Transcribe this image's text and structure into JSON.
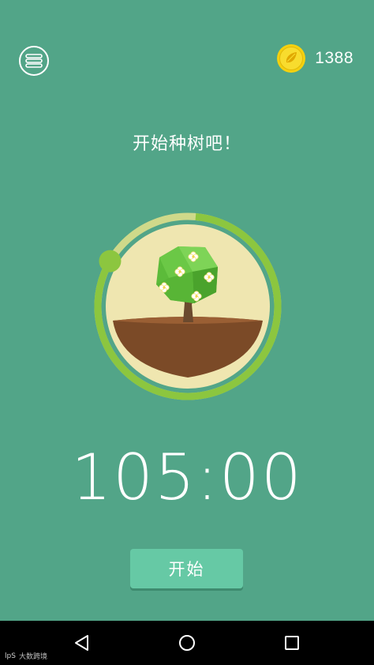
{
  "header": {
    "menu_icon": "menu-lines-icon",
    "coin_icon": "seed-coin-icon",
    "coin_count": "1388"
  },
  "main": {
    "prompt": "开始种树吧！",
    "timer": "105:00",
    "timer_progress_fraction": 0.82,
    "start_label": "开始"
  },
  "navbar": {
    "back_icon": "back-triangle-icon",
    "home_icon": "home-circle-icon",
    "recent_icon": "recent-square-icon"
  },
  "watermark": {
    "logo": "lpS",
    "text": "大数跨境"
  },
  "colors": {
    "background": "#52a588",
    "ring_active": "#8cc63f",
    "ring_track": "#cfd98a",
    "dial_fill": "#efe6b0",
    "soil": "#7b4a27",
    "button": "#66c9a5",
    "coin": "#f5d10f"
  }
}
